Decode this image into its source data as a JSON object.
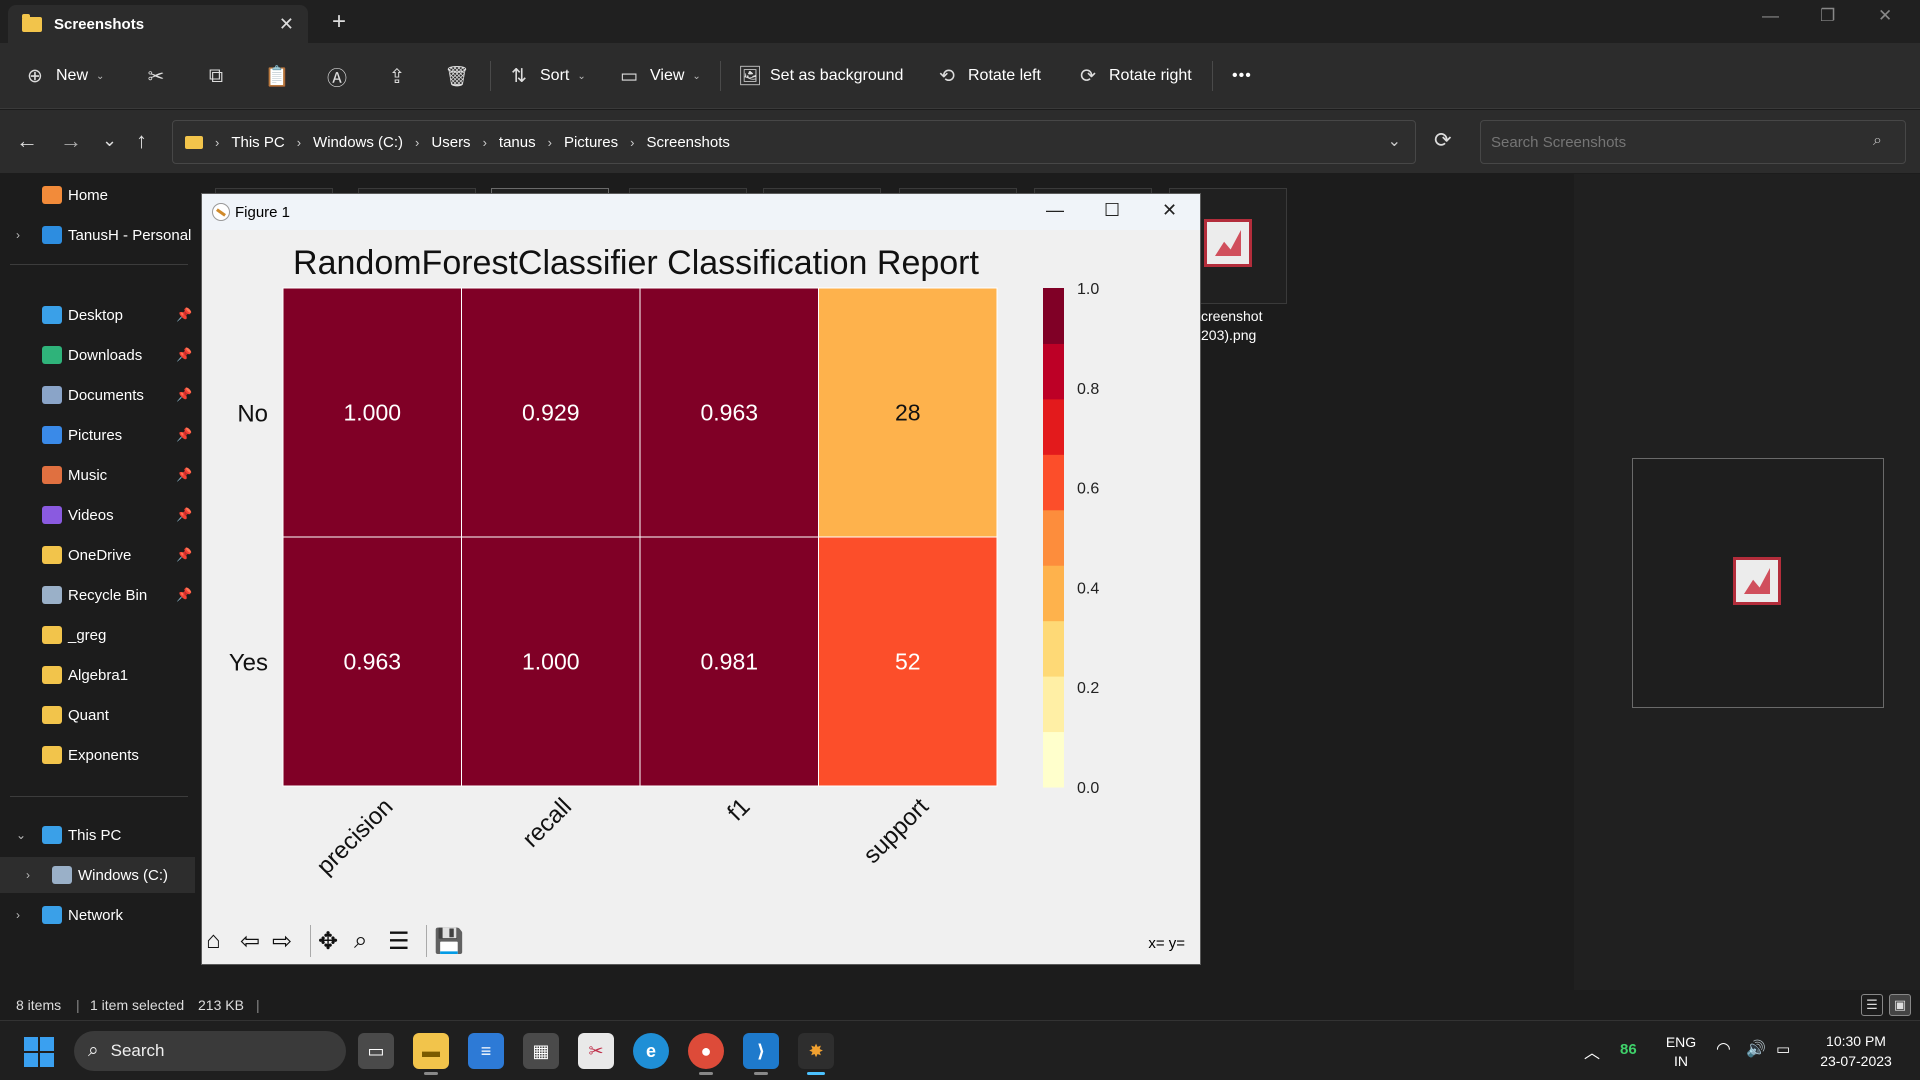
{
  "explorer": {
    "tab_title": "Screenshots",
    "tab_close": "✕",
    "new_tab": "+",
    "commands": {
      "new_label": "New",
      "sort_label": "Sort",
      "view_label": "View",
      "set_background_label": "Set as background",
      "rotate_left_label": "Rotate left",
      "rotate_right_label": "Rotate right",
      "more_label": "•••"
    },
    "breadcrumbs": [
      "This PC",
      "Windows (C:)",
      "Users",
      "tanus",
      "Pictures",
      "Screenshots"
    ],
    "search_placeholder": "Search Screenshots",
    "sidebar": {
      "quick": [
        {
          "label": "Home",
          "color": "#f28b3a",
          "expand": ""
        },
        {
          "label": "TanusH - Personal",
          "color": "#2d8de0",
          "expand": "›"
        }
      ],
      "pinned": [
        {
          "label": "Desktop",
          "color": "#3aa0e8"
        },
        {
          "label": "Downloads",
          "color": "#2fb37a"
        },
        {
          "label": "Documents",
          "color": "#8aa4c8"
        },
        {
          "label": "Pictures",
          "color": "#3a8ae8"
        },
        {
          "label": "Music",
          "color": "#e07040"
        },
        {
          "label": "Videos",
          "color": "#8a5ae0"
        },
        {
          "label": "OneDrive",
          "color": "#f2c44b"
        },
        {
          "label": "Recycle Bin",
          "color": "#9ab0c8"
        }
      ],
      "folders": [
        {
          "label": "_greg",
          "color": "#f2c44b"
        },
        {
          "label": "Algebra1",
          "color": "#f2c44b"
        },
        {
          "label": "Quant",
          "color": "#f2c44b"
        },
        {
          "label": "Exponents",
          "color": "#f2c44b"
        }
      ],
      "drives": [
        {
          "label": "This PC",
          "color": "#3aa0e8",
          "expand": "⌄"
        },
        {
          "label": "Windows (C:)",
          "color": "#9ab0c8",
          "expand": "›"
        },
        {
          "label": "Network",
          "color": "#3aa0e8",
          "expand": "›"
        }
      ],
      "pin_glyph": "📌"
    },
    "file_label_line1": "creenshot",
    "file_label_line2": "203).png",
    "status": {
      "items": "8 items",
      "selected": "1 item selected",
      "size": "213 KB"
    }
  },
  "figure": {
    "title": "Figure 1",
    "coords": "x= y=",
    "toolbar_icons": [
      "home-icon",
      "back-icon",
      "forward-icon",
      "pan-icon",
      "zoom-icon",
      "configure-icon",
      "save-icon"
    ]
  },
  "chart_data": {
    "type": "heatmap",
    "title": "RandomForestClassifier Classification Report",
    "rows": [
      "No",
      "Yes"
    ],
    "columns": [
      "precision",
      "recall",
      "f1",
      "support"
    ],
    "cells": [
      [
        "1.000",
        "0.929",
        "0.963",
        "28"
      ],
      [
        "0.963",
        "1.000",
        "0.981",
        "52"
      ]
    ],
    "values": [
      [
        1.0,
        0.929,
        0.963,
        0.35
      ],
      [
        0.963,
        1.0,
        0.981,
        0.65
      ]
    ],
    "colorbar": {
      "ticks": [
        "0.0",
        "0.2",
        "0.4",
        "0.6",
        "0.8",
        "1.0"
      ],
      "range": [
        0,
        1
      ],
      "colors": [
        "#ffffcc",
        "#ffefa5",
        "#fed976",
        "#feb24c",
        "#fd8d3c",
        "#fc4e2a",
        "#e31a1c",
        "#bd0026",
        "#800026"
      ]
    },
    "cell_colors": [
      [
        "#800026",
        "#800026",
        "#800026",
        "#feb24c"
      ],
      [
        "#800026",
        "#800026",
        "#800026",
        "#fc4e2a"
      ]
    ]
  },
  "taskbar": {
    "search_label": "Search",
    "battery_level": "86",
    "lang_line1": "ENG",
    "lang_line2": "IN",
    "time": "10:30 PM",
    "date": "23-07-2023"
  }
}
